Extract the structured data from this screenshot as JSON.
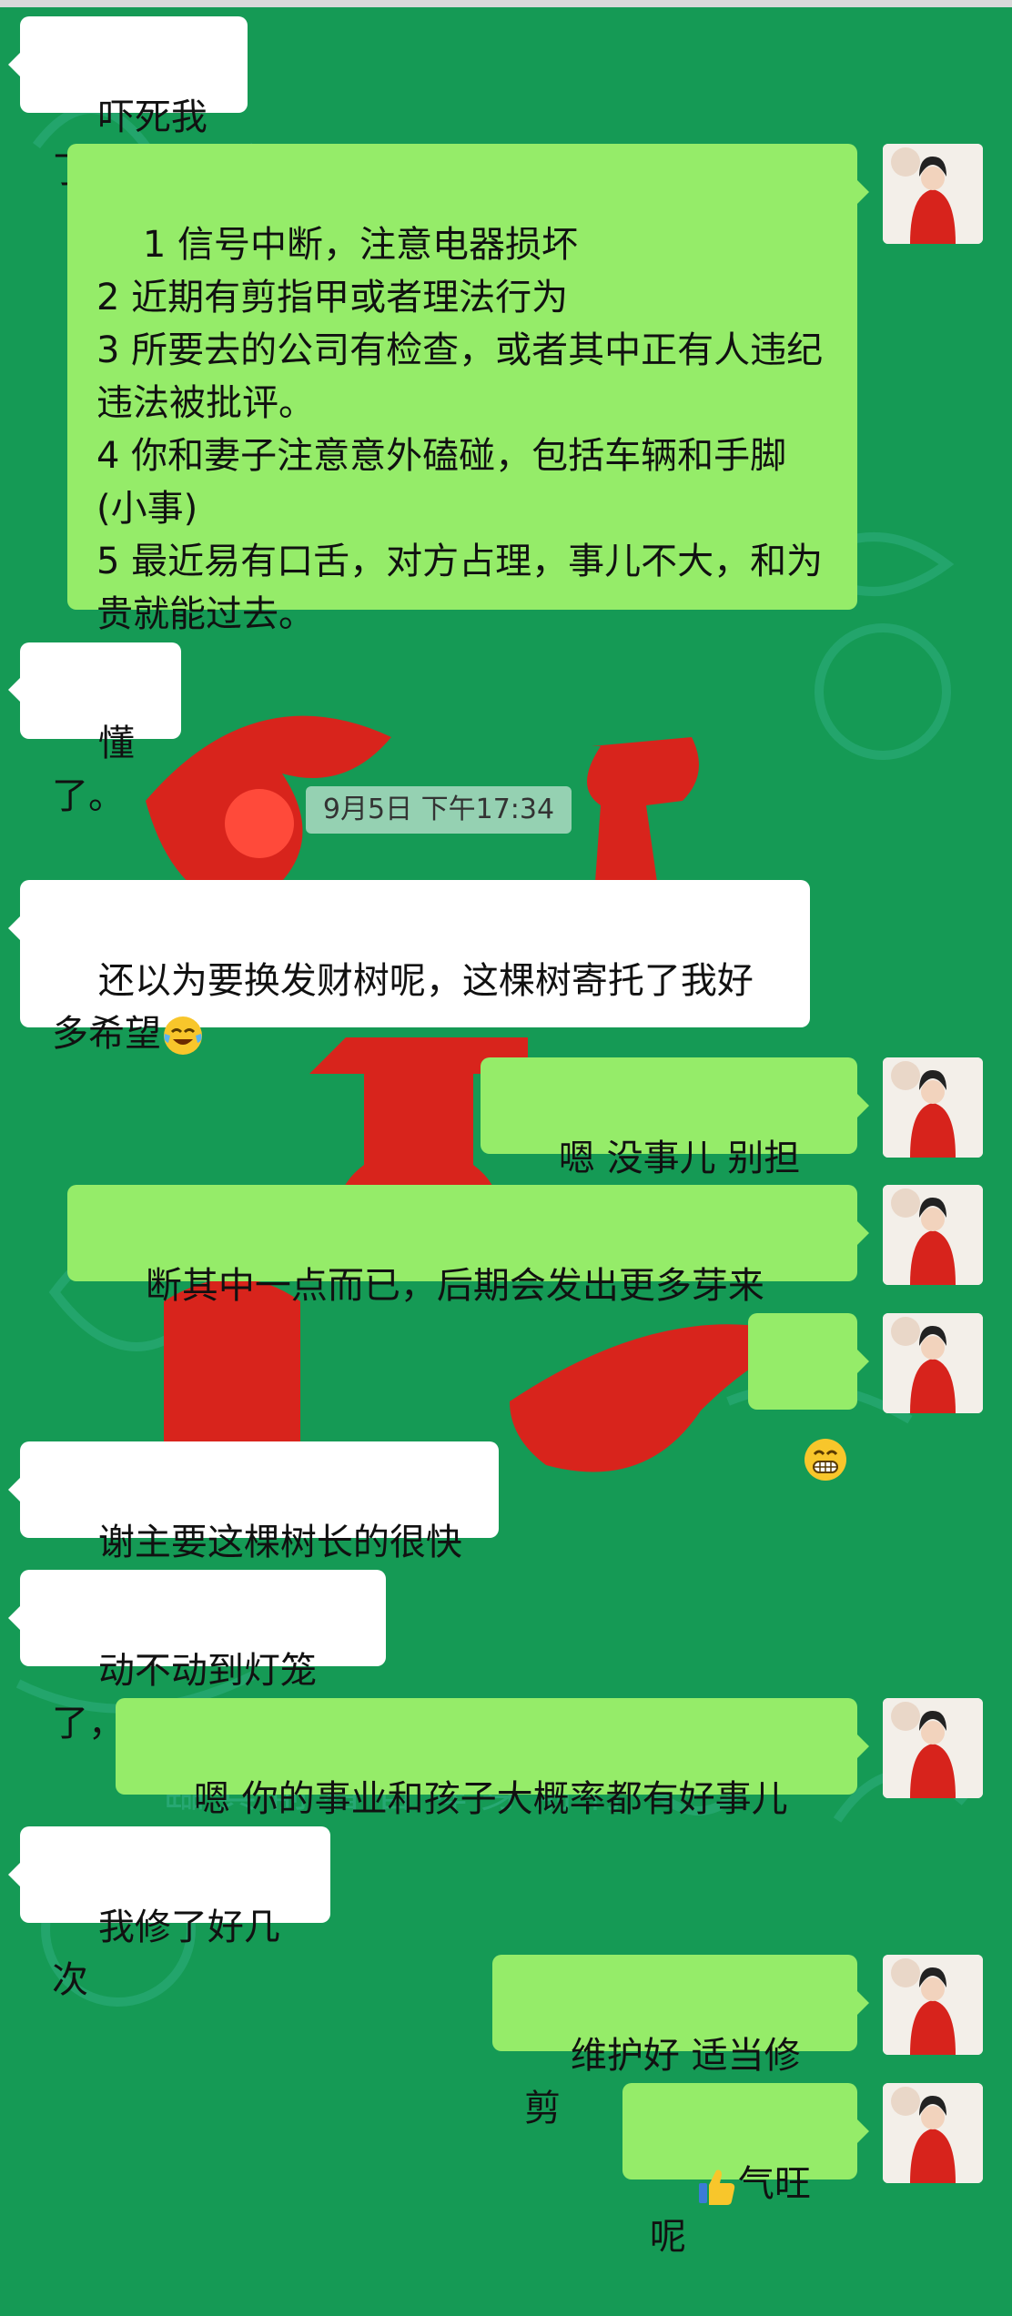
{
  "timestamp": "9月5日 下午17:34",
  "messages": [
    {
      "side": "recv",
      "text": "吓死我了"
    },
    {
      "side": "sent",
      "text": "1 信号中断，注意电器损坏\n2 近期有剪指甲或者理法行为\n3 所要去的公司有检查，或者其中正有人违纪违法被批评。\n4 你和妻子注意意外磕碰，包括车辆和手脚(小事)\n5 最近易有口舌，对方占理，事儿不大，和为贵就能过去。"
    },
    {
      "side": "recv",
      "text": "懂了。"
    },
    {
      "side": "recv",
      "text": "还以为要换发财树呢，这棵树寄托了我好多希望",
      "emoji": "crying-laughing-emoji"
    },
    {
      "side": "sent",
      "text": "嗯 没事儿 别担忧"
    },
    {
      "side": "sent",
      "text": "断其中一点而已，后期会发出更多芽来"
    },
    {
      "side": "sent",
      "text": "",
      "emoji": "grinning-emoji"
    },
    {
      "side": "recv",
      "text": "谢主要这棵树长的很快"
    },
    {
      "side": "recv",
      "text": "动不动到灯笼了，"
    },
    {
      "side": "sent",
      "text": "嗯 你的事业和孩子大概率都有好事儿"
    },
    {
      "side": "recv",
      "text": "我修了好几次"
    },
    {
      "side": "sent",
      "text": "维护好 适当修剪"
    },
    {
      "side": "sent",
      "text": "气旺呢",
      "emoji": "thumbs-up-emoji"
    }
  ],
  "colors": {
    "background": "#159a55",
    "sent_bubble": "#95ec69",
    "received_bubble": "#ffffff"
  }
}
